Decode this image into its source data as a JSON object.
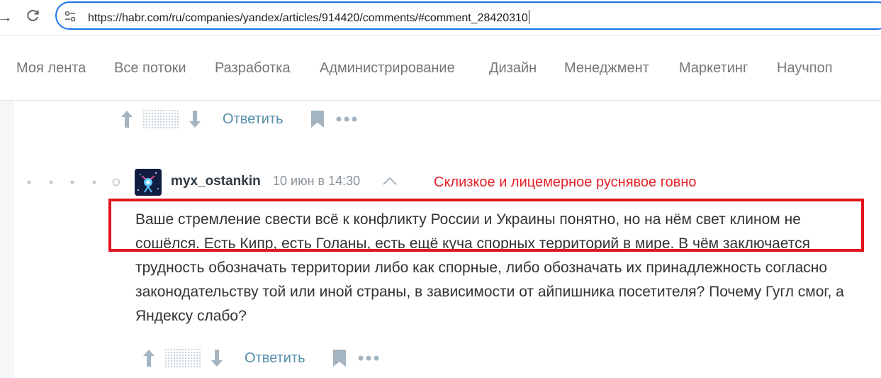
{
  "browser": {
    "url": "https://habr.com/ru/companies/yandex/articles/914420/comments/#comment_28420310",
    "forward_glyph": "→"
  },
  "nav": {
    "items": [
      "Моя лента",
      "Все потоки",
      "Разработка",
      "Администрирование",
      "Дизайн",
      "Менеджмент",
      "Маркетинг",
      "Научпоп"
    ]
  },
  "top_actions": {
    "reply_label": "Ответить"
  },
  "comment": {
    "username": "myx_ostankin",
    "timestamp": "10 июн в 14:30",
    "body": "Ваше стремление свести всё к конфликту России и Украины понятно, но на нём свет клином не сошёлся. Есть Кипр, есть Голаны, есть ещё куча спорных территорий в мире. В чём заключается трудность обозначать территории либо как спорные, либо обозначать их принадлежность согласно законодательству той или иной страны, в зависимости от айпишника посетителя? Почему Гугл смог, а Яндексу слабо?",
    "reply_label": "Ответить"
  },
  "annotation": {
    "text": "Склизкое и лицемерное руснявое говно",
    "color": "#e3121d"
  },
  "colors": {
    "link": "#548eaa",
    "url_border": "#1a73e8",
    "nav_text": "#757679",
    "icon_gray": "#a4b4c1"
  },
  "icons": [
    "reload-icon",
    "site-info-icon",
    "arrow-up-icon",
    "arrow-down-icon",
    "bookmark-icon",
    "more-icon",
    "collapse-icon",
    "avatar"
  ]
}
